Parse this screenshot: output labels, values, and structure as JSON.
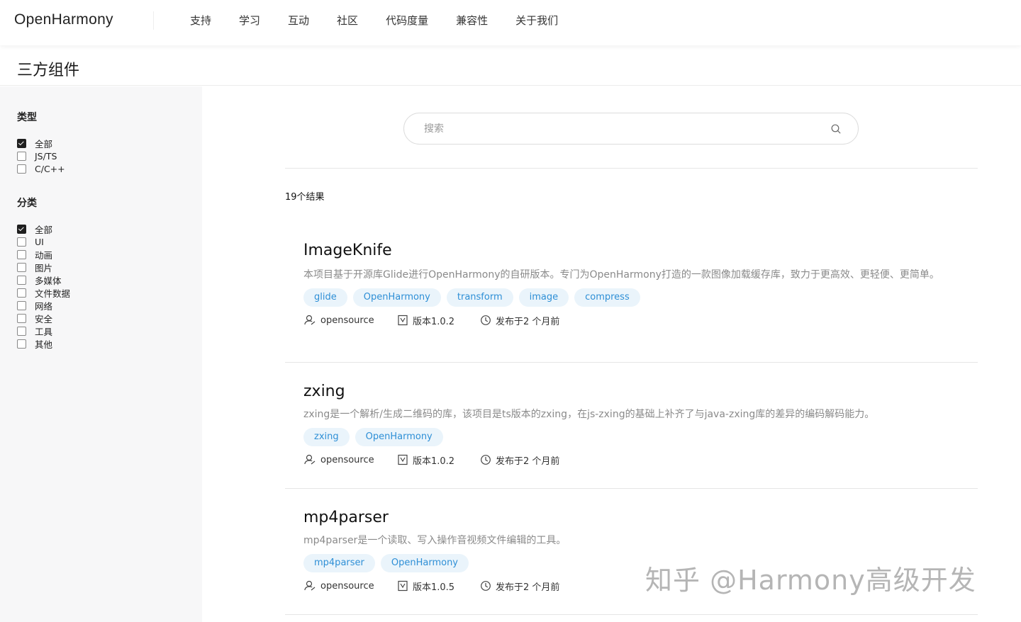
{
  "nav": {
    "logo": "OpenHarmony",
    "items": [
      "支持",
      "学习",
      "互动",
      "社区",
      "代码度量",
      "兼容性",
      "关于我们"
    ]
  },
  "page": {
    "title": "三方组件"
  },
  "sidebar": {
    "type_group": {
      "title": "类型",
      "options": [
        {
          "label": "全部",
          "checked": true
        },
        {
          "label": "JS/TS",
          "checked": false
        },
        {
          "label": "C/C++",
          "checked": false
        }
      ]
    },
    "category_group": {
      "title": "分类",
      "options": [
        {
          "label": "全部",
          "checked": true
        },
        {
          "label": "UI",
          "checked": false
        },
        {
          "label": "动画",
          "checked": false
        },
        {
          "label": "图片",
          "checked": false
        },
        {
          "label": "多媒体",
          "checked": false
        },
        {
          "label": "文件数据",
          "checked": false
        },
        {
          "label": "网络",
          "checked": false
        },
        {
          "label": "安全",
          "checked": false
        },
        {
          "label": "工具",
          "checked": false
        },
        {
          "label": "其他",
          "checked": false
        }
      ]
    }
  },
  "search": {
    "placeholder": "搜索",
    "value": ""
  },
  "results": {
    "count_text": "19个结果",
    "items": [
      {
        "name": "ImageKnife",
        "description": "本项目基于开源库Glide进行OpenHarmony的自研版本。专门为OpenHarmony打造的一款图像加载缓存库，致力于更高效、更轻便、更简单。",
        "tags": [
          "glide",
          "OpenHarmony",
          "transform",
          "image",
          "compress"
        ],
        "author": "opensource",
        "version": "版本1.0.2",
        "published": "发布于2 个月前"
      },
      {
        "name": "zxing",
        "description": "zxing是一个解析/生成二维码的库，该项目是ts版本的zxing，在js-zxing的基础上补齐了与java-zxing库的差异的编码解码能力。",
        "tags": [
          "zxing",
          "OpenHarmony"
        ],
        "author": "opensource",
        "version": "版本1.0.2",
        "published": "发布于2 个月前"
      },
      {
        "name": "mp4parser",
        "description": "mp4parser是一个读取、写入操作音视频文件编辑的工具。",
        "tags": [
          "mp4parser",
          "OpenHarmony"
        ],
        "author": "opensource",
        "version": "版本1.0.5",
        "published": "发布于2 个月前"
      }
    ]
  },
  "watermark": "知乎 @Harmony高级开发",
  "colors": {
    "tag_bg": "#eaf4fb",
    "tag_text": "#2e8fd6",
    "sidebar_bg": "#f7f7f8"
  }
}
